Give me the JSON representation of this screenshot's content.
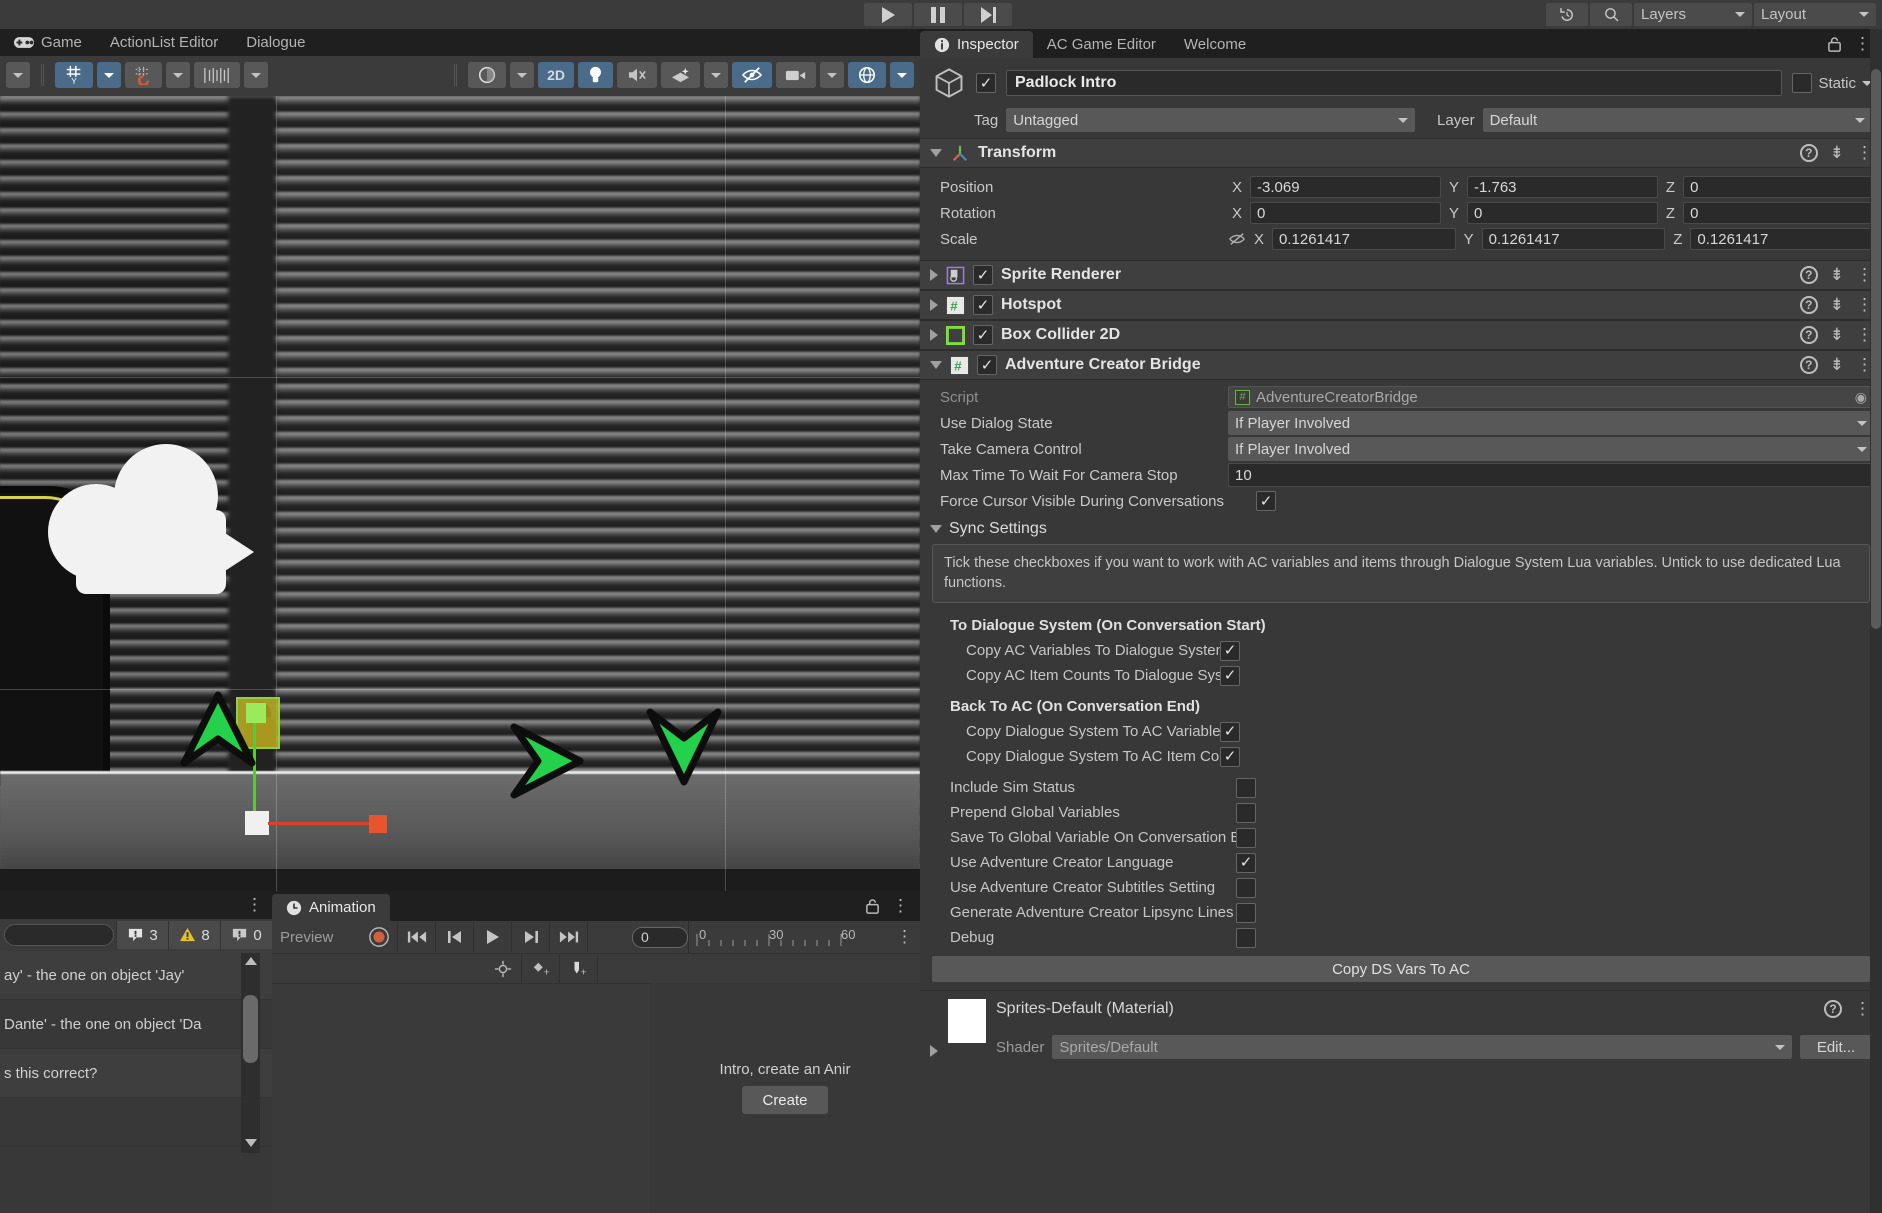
{
  "toolbar": {
    "play_icon": "play-icon",
    "pause_icon": "pause-icon",
    "step_icon": "step-icon",
    "history_icon": "history-icon",
    "search_icon": "search-icon",
    "layers_label": "Layers",
    "layout_label": "Layout"
  },
  "scene_panel": {
    "tabs": [
      {
        "label": "Game",
        "icon": "gamepad-icon",
        "active": false
      },
      {
        "label": "ActionList Editor",
        "icon": "",
        "active": false
      },
      {
        "label": "Dialogue",
        "icon": "",
        "active": false
      }
    ],
    "toolbar": {
      "shading_icon": "shading-mode-icon",
      "view_2d_label": "2D",
      "lighting_icon": "lightbulb-icon",
      "audio_icon": "audio-mute-icon",
      "fx_icon": "effects-icon",
      "hidden_icon": "visibility-off-icon",
      "camera_icon": "scene-camera-icon",
      "gizmos_icon": "gizmos-icon",
      "grid_axis_icon": "grid-axis-y-icon",
      "snap_icon": "snap-magnet-icon",
      "ruler_icon": "ruler-icon"
    },
    "gizmo": {
      "x_axis_color": "#d4432a",
      "y_axis_color": "#5ec63a",
      "selection_outline_color": "#8dd23f"
    },
    "nav_arrows": [
      "arrow-up",
      "arrow-right",
      "arrow-down"
    ]
  },
  "inspector": {
    "tabs": [
      {
        "label": "Inspector",
        "icon": "info-icon",
        "active": true
      },
      {
        "label": "AC Game Editor",
        "icon": "",
        "active": false
      },
      {
        "label": "Welcome",
        "icon": "",
        "active": false
      }
    ],
    "lock_icon": "lock-icon",
    "kebab_icon": "kebab-menu-icon",
    "object": {
      "enabled": true,
      "name": "Padlock Intro",
      "static_label": "Static",
      "static_checked": false,
      "tag_label": "Tag",
      "tag_value": "Untagged",
      "layer_label": "Layer",
      "layer_value": "Default"
    },
    "transform": {
      "title": "Transform",
      "expanded": true,
      "rows": [
        {
          "label": "Position",
          "x": "-3.069",
          "y": "-1.763",
          "z": "0"
        },
        {
          "label": "Rotation",
          "x": "0",
          "y": "0",
          "z": "0"
        },
        {
          "label": "Scale",
          "x": "0.1261417",
          "y": "0.1261417",
          "z": "0.1261417",
          "link_icon": "scale-unlink-icon"
        }
      ],
      "axis_labels": [
        "X",
        "Y",
        "Z"
      ]
    },
    "components": [
      {
        "title": "Sprite Renderer",
        "enabled": true,
        "expanded": false,
        "icon": "sprite-renderer-icon"
      },
      {
        "title": "Hotspot",
        "enabled": true,
        "expanded": false,
        "icon": "script-icon"
      },
      {
        "title": "Box Collider 2D",
        "enabled": true,
        "expanded": false,
        "icon": "box-collider-2d-icon"
      },
      {
        "title": "Adventure Creator Bridge",
        "enabled": true,
        "expanded": true,
        "icon": "script-icon"
      }
    ],
    "bridge": {
      "script_label": "Script",
      "script_value": "AdventureCreatorBridge",
      "script_picker_icon": "object-picker-icon",
      "fields": [
        {
          "label": "Use Dialog State",
          "type": "dropdown",
          "value": "If Player Involved"
        },
        {
          "label": "Take Camera Control",
          "type": "dropdown",
          "value": "If Player Involved"
        },
        {
          "label": "Max Time To Wait For Camera Stop",
          "type": "number",
          "value": "10"
        },
        {
          "label": "Force Cursor Visible During Conversations",
          "type": "checkbox",
          "checked": true
        }
      ],
      "sync_settings": {
        "title": "Sync Settings",
        "expanded": true,
        "help_text": "Tick these checkboxes if you want to work with AC variables and items through Dialogue System Lua variables. Untick to use dedicated Lua functions.",
        "groups": [
          {
            "heading": "To Dialogue System (On Conversation Start)",
            "items": [
              {
                "label": "Copy AC Variables To Dialogue System",
                "checked": true
              },
              {
                "label": "Copy AC Item Counts To Dialogue Syste",
                "checked": true
              }
            ]
          },
          {
            "heading": "Back To AC (On Conversation End)",
            "items": [
              {
                "label": "Copy Dialogue System To AC Variables",
                "checked": true
              },
              {
                "label": "Copy Dialogue System To AC Item Coun",
                "checked": true
              }
            ]
          }
        ],
        "extra_items": [
          {
            "label": "Include Sim Status",
            "checked": false
          },
          {
            "label": "Prepend Global Variables",
            "checked": false
          },
          {
            "label": "Save To Global Variable On Conversation E",
            "checked": false
          },
          {
            "label": "Use Adventure Creator Language",
            "checked": true
          },
          {
            "label": "Use Adventure Creator Subtitles Setting",
            "checked": false
          },
          {
            "label": "Generate Adventure Creator Lipsync Lines",
            "checked": false
          },
          {
            "label": "Debug",
            "checked": false
          }
        ],
        "action_button": "Copy DS Vars To AC"
      }
    },
    "material": {
      "title": "Sprites-Default (Material)",
      "shader_label": "Shader",
      "shader_value": "Sprites/Default",
      "edit_button": "Edit...",
      "swatch_color": "#ffffff"
    }
  },
  "console": {
    "kebab_icon": "kebab-menu-icon",
    "search_placeholder": "",
    "counts": {
      "errors": "3",
      "warnings": "8",
      "infos": "0"
    },
    "entries": [
      "ay' - the one on object 'Jay'",
      "Dante' - the one on object 'Da",
      "s this correct?"
    ]
  },
  "animation": {
    "tab_label": "Animation",
    "tab_icon": "clock-icon",
    "lock_icon": "lock-icon",
    "kebab_icon": "kebab-menu-icon",
    "preview_label": "Preview",
    "record_icon": "record-icon",
    "first_frame_icon": "skip-to-start-icon",
    "prev_frame_icon": "previous-frame-icon",
    "play_icon": "play-icon",
    "next_frame_icon": "next-frame-icon",
    "last_frame_icon": "skip-to-end-icon",
    "frame_value": "0",
    "ruler_ticks": [
      "0",
      "30",
      "60"
    ],
    "add_property_icon": "add-keyframe-target-icon",
    "add_keyframe_icon": "add-keyframe-icon",
    "add_event_icon": "add-event-icon",
    "empty_message": "Intro, create an Anir",
    "create_button": "Create"
  }
}
